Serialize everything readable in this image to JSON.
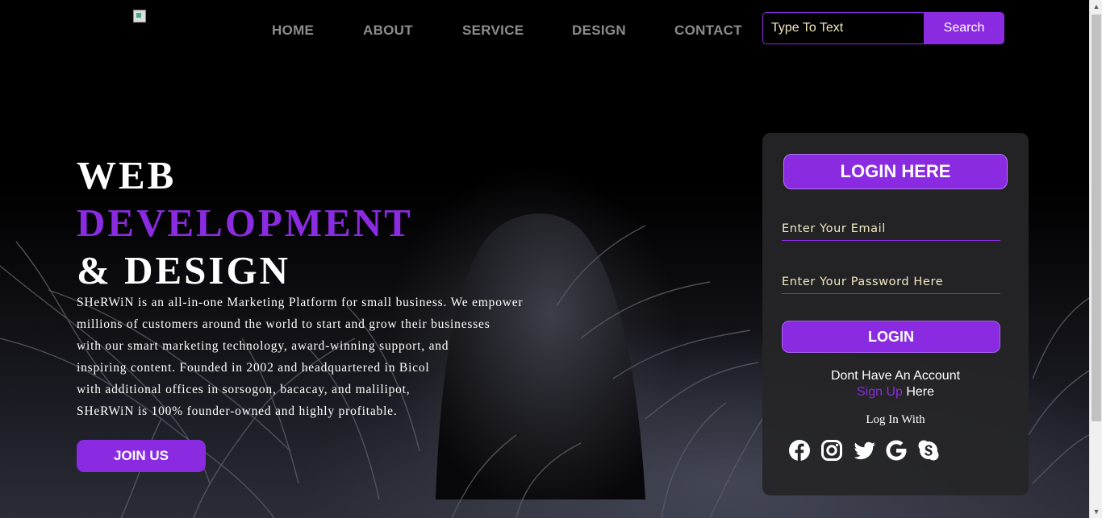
{
  "nav": {
    "items": [
      {
        "label": "HOME"
      },
      {
        "label": "ABOUT"
      },
      {
        "label": "SERVICE"
      },
      {
        "label": "DESIGN"
      },
      {
        "label": "CONTACT"
      }
    ]
  },
  "search": {
    "placeholder": "Type To Text",
    "button_label": "Search"
  },
  "hero": {
    "line1": "WEB",
    "line2": "DEVELOPMENT",
    "line3": "& DESIGN",
    "paragraph": [
      "SHeRWiN is an all-in-one Marketing Platform for small business. We empower",
      "millions of customers around the world to start and grow their businesses",
      "with our smart marketing technology, award-winning support, and",
      "inspiring content. Founded in 2002 and headquartered in Bicol",
      "with additional offices in sorsogon, bacacay, and malilipot,",
      "SHeRWiN is 100% founder-owned and highly profitable."
    ],
    "join_label": "JOIN US"
  },
  "login": {
    "title": "LOGIN HERE",
    "email_placeholder": "Enter Your Email",
    "password_placeholder": "Enter Your Password Here",
    "button_label": "LOGIN",
    "no_account": "Dont Have An Account",
    "signup_link": "Sign Up",
    "signup_suffix": " Here",
    "login_with": "Log In With",
    "socials": [
      "facebook-icon",
      "instagram-icon",
      "twitter-icon",
      "google-icon",
      "skype-icon"
    ]
  },
  "colors": {
    "accent": "#8a2be2",
    "nav_text": "#8c8c8c",
    "placeholder_text": "#f2e7c0",
    "top_border": "#d21a1a"
  }
}
